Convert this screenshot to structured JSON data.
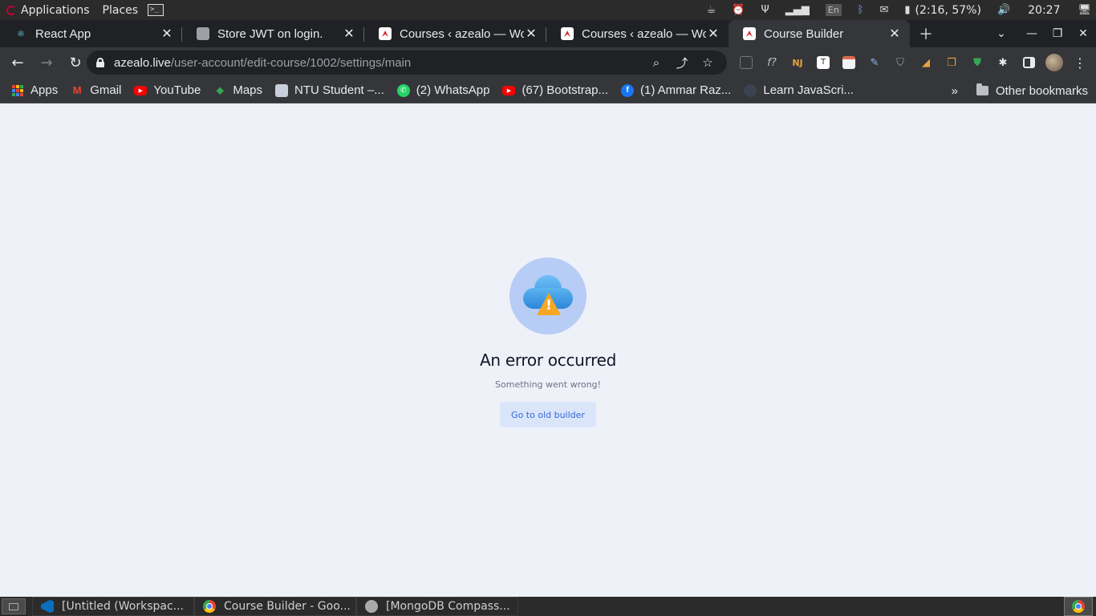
{
  "system_panel": {
    "applications_label": "Applications",
    "places_label": "Places",
    "keyboard_layout": "En",
    "battery_text": "(2:16, 57%)",
    "clock": "20:27"
  },
  "tabs": [
    {
      "title": "React App",
      "favicon": "react-icon"
    },
    {
      "title": "Store JWT on login.",
      "favicon": "openai-icon"
    },
    {
      "title": "Courses ‹ azealo — Wor",
      "favicon": "wordpress-site-icon"
    },
    {
      "title": "Courses ‹ azealo — Wor",
      "favicon": "wordpress-site-icon"
    },
    {
      "title": "Course Builder",
      "favicon": "wordpress-site-icon",
      "active": true
    }
  ],
  "omnibox": {
    "host": "azealo.live",
    "path": "/user-account/edit-course/1002/settings/main"
  },
  "bookmarks": {
    "items": [
      {
        "label": "Apps"
      },
      {
        "label": "Gmail"
      },
      {
        "label": "YouTube"
      },
      {
        "label": "Maps"
      },
      {
        "label": "NTU Student –..."
      },
      {
        "label": "(2) WhatsApp"
      },
      {
        "label": "(67) Bootstrap..."
      },
      {
        "label": "(1) Ammar Raz..."
      },
      {
        "label": "Learn JavaScri..."
      }
    ],
    "more_label": "»",
    "other_label": "Other bookmarks"
  },
  "page": {
    "error_title": "An error occurred",
    "error_subtitle": "Something went wrong!",
    "old_builder_button": "Go to old builder"
  },
  "taskbar": {
    "items": [
      {
        "label": "[Untitled (Workspac..."
      },
      {
        "label": "Course Builder - Goo..."
      },
      {
        "label": "[MongoDB Compass..."
      }
    ]
  },
  "colors": {
    "page_background": "#eff1f9",
    "button_background": "#dbe5f9",
    "button_text": "#3468d6",
    "illustration_circle": "#b8cdf5",
    "warning": "#f5a623"
  }
}
